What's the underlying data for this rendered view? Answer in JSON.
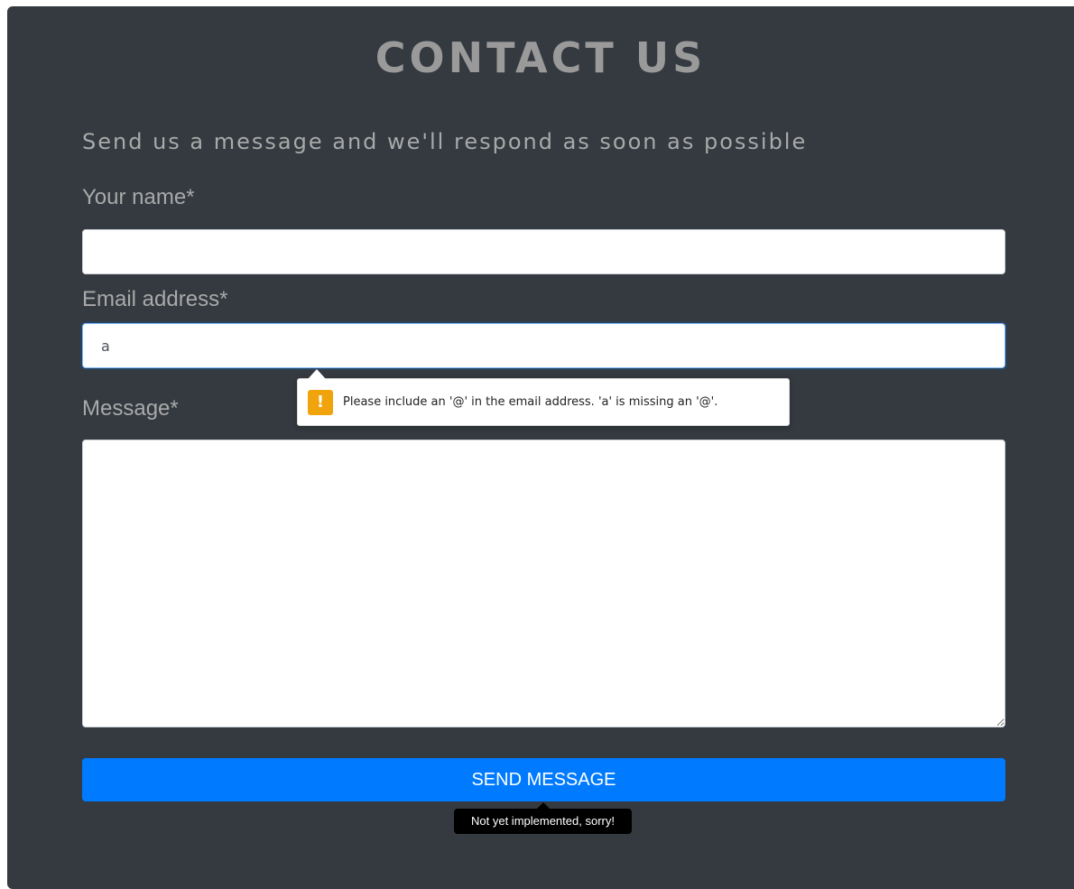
{
  "page": {
    "title": "CONTACT US",
    "subtitle": "Send us a message and we'll respond as soon as possible"
  },
  "form": {
    "name_label": "Your name*",
    "name_value": "",
    "email_label": "Email address*",
    "email_value": "a",
    "message_label": "Message*",
    "message_value": "",
    "submit_label": "SEND MESSAGE"
  },
  "validation": {
    "icon": "warning-icon",
    "icon_glyph": "!",
    "message": "Please include an '@' in the email address. 'a' is missing an '@'."
  },
  "tooltip": {
    "text": "Not yet implemented, sorry!"
  },
  "colors": {
    "panel_background": "#343a40",
    "primary_button": "#007bff",
    "warning": "#f0a30a"
  }
}
